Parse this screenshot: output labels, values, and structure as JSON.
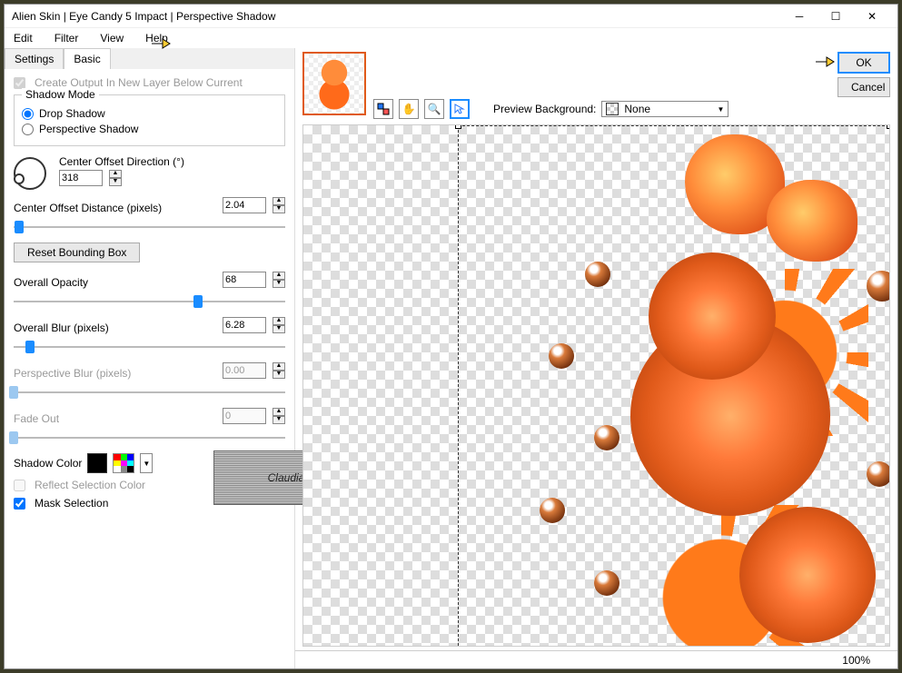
{
  "title": "Alien Skin | Eye Candy 5 Impact | Perspective Shadow",
  "menu": {
    "edit": "Edit",
    "filter": "Filter",
    "view": "View",
    "help": "Help"
  },
  "tabs": {
    "settings": "Settings",
    "basic": "Basic"
  },
  "panel": {
    "create_output": "Create Output In New Layer Below Current",
    "shadow_mode": "Shadow Mode",
    "drop_shadow": "Drop Shadow",
    "perspective_shadow": "Perspective Shadow",
    "center_offset_dir": "Center Offset Direction (°)",
    "center_offset_dir_val": "318",
    "center_offset_dist": "Center Offset Distance (pixels)",
    "center_offset_dist_val": "2.04",
    "reset_bbox": "Reset Bounding Box",
    "overall_opacity": "Overall Opacity",
    "overall_opacity_val": "68",
    "overall_blur": "Overall Blur (pixels)",
    "overall_blur_val": "6.28",
    "perspective_blur": "Perspective Blur (pixels)",
    "perspective_blur_val": "0.00",
    "fade_out": "Fade Out",
    "fade_out_val": "0",
    "shadow_color": "Shadow Color",
    "shadow_color_val": "#000000",
    "reflect_sel": "Reflect Selection Color",
    "mask_sel": "Mask Selection",
    "watermark": "Claudia"
  },
  "buttons": {
    "ok": "OK",
    "cancel": "Cancel"
  },
  "previewbar": {
    "label": "Preview Background:",
    "value": "None"
  },
  "status": {
    "zoom": "100%"
  }
}
